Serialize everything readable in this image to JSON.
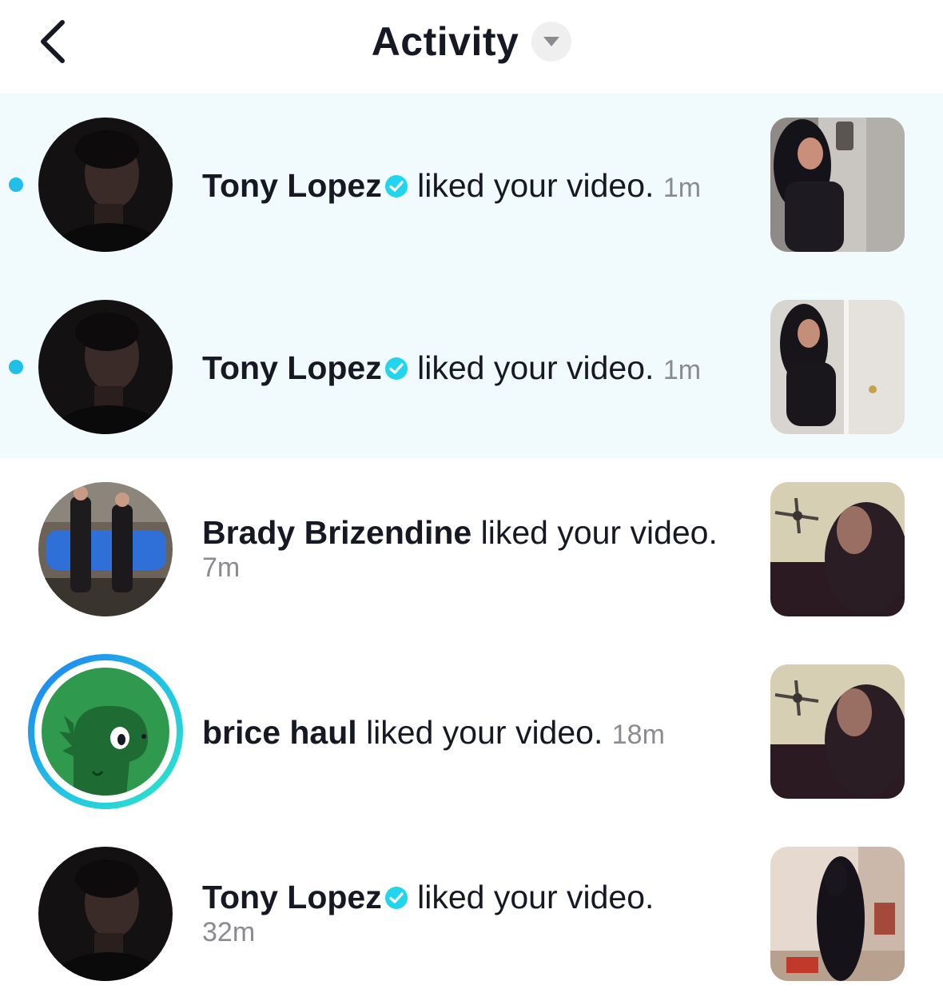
{
  "header": {
    "title": "Activity"
  },
  "items": [
    {
      "username": "Tony Lopez",
      "verified": true,
      "action": "liked your video.",
      "time": "1m",
      "unread": true
    },
    {
      "username": "Tony Lopez",
      "verified": true,
      "action": "liked your video.",
      "time": "1m",
      "unread": true
    },
    {
      "username": "Brady Brizendine",
      "verified": false,
      "action": "liked your video.",
      "time": "7m",
      "unread": false
    },
    {
      "username": "brice haul",
      "verified": false,
      "action": "liked your video.",
      "time": "18m",
      "unread": false,
      "has_story": true
    },
    {
      "username": "Tony Lopez",
      "verified": true,
      "action": "liked your video.",
      "time": "32m",
      "unread": false
    }
  ],
  "colors": {
    "unread_background": "#f1fafc",
    "unread_dot": "#20bfe8",
    "verified_badge": "#20d5ec",
    "timestamp": "#8a8b91"
  }
}
